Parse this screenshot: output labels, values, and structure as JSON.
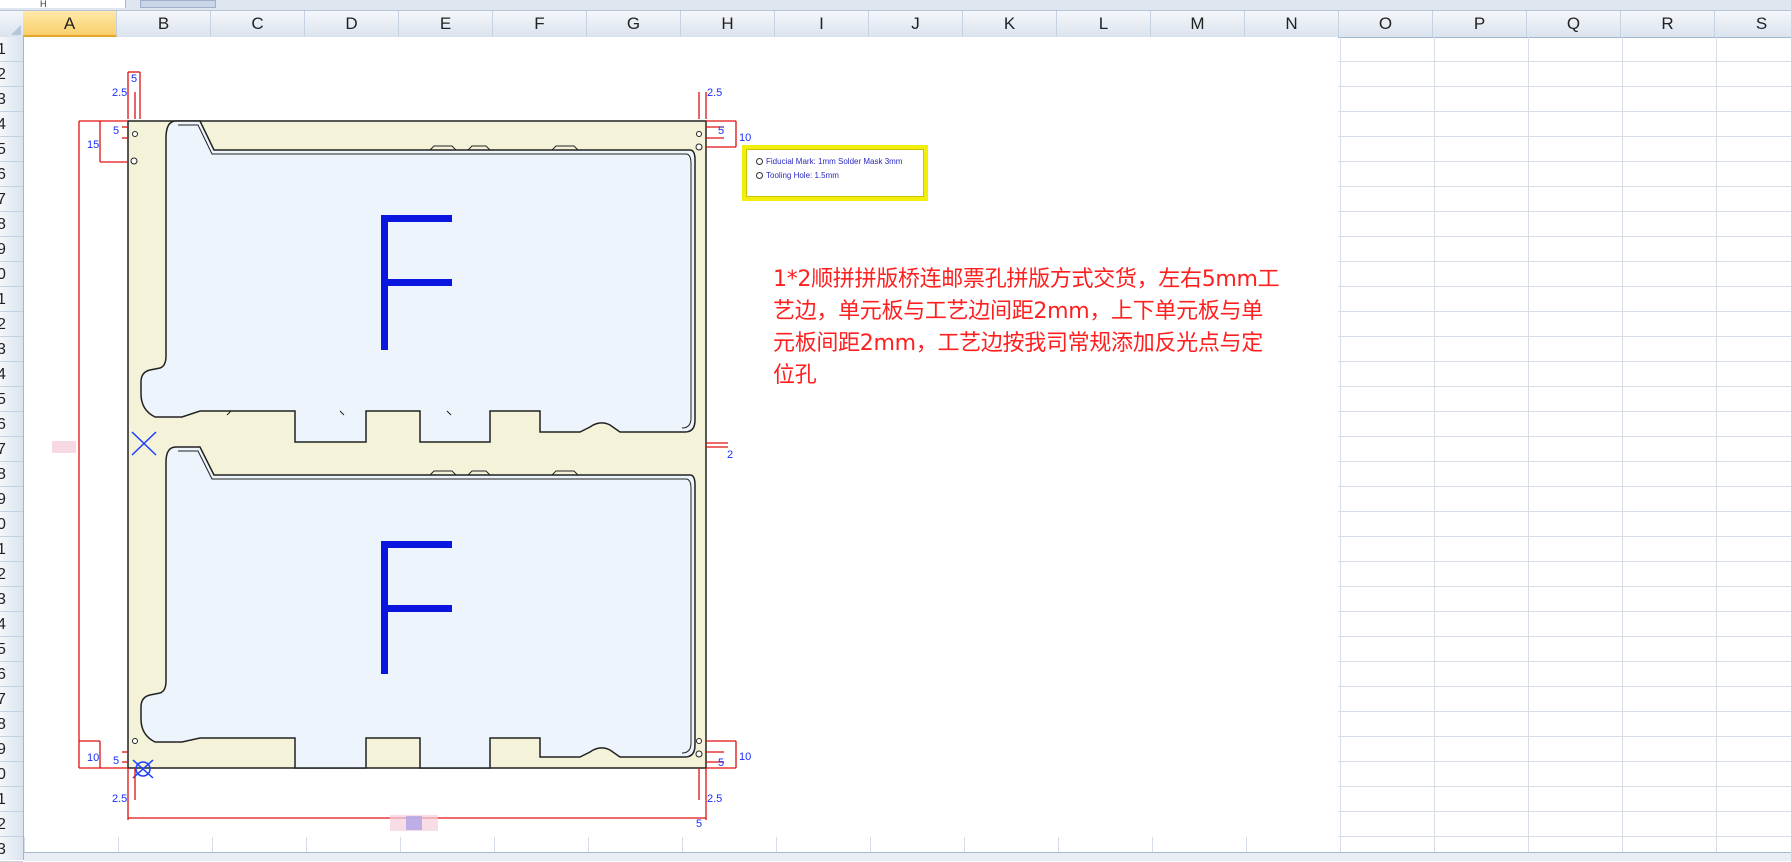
{
  "toolbar": {
    "name_box": "H"
  },
  "columns": [
    "A",
    "B",
    "C",
    "D",
    "E",
    "F",
    "G",
    "H",
    "I",
    "J",
    "K",
    "L",
    "M",
    "N",
    "O",
    "P",
    "Q",
    "R",
    "S"
  ],
  "rows": [
    "1",
    "2",
    "3",
    "4",
    "5",
    "6",
    "7",
    "8",
    "9",
    "0",
    "1",
    "2",
    "3",
    "4",
    "5",
    "6",
    "7",
    "8",
    "9",
    "0",
    "1",
    "2",
    "3",
    "4",
    "5",
    "6",
    "7",
    "8",
    "9",
    "0",
    "1",
    "2",
    "3"
  ],
  "selected_column": "A",
  "drawing": {
    "panel_letter_top": "F",
    "panel_letter_bottom": "F",
    "dimensions": {
      "top_left_width": "5",
      "top_left_offset": "2.5",
      "left_height": "15",
      "top_left_small": "5",
      "top_right_offset": "2.5",
      "top_right_small": "5",
      "top_right_height": "10",
      "middle_gap": "2",
      "bottom_left_height": "10",
      "bottom_left_small": "5",
      "bottom_left_offset": "2.5",
      "bottom_right_height": "10",
      "bottom_right_small": "5",
      "bottom_right_offset": "2.5",
      "bottom_width": "5"
    },
    "legend": {
      "line1": "Fiducial Mark: 1mm Solder Mask 3mm",
      "line2": "Tooling Hole: 1.5mm"
    }
  },
  "note": "1*2顺拼拼版桥连邮票孔拼版方式交货，左右5mm工艺边，单元板与工艺边间距2mm，上下单元板与单元板间距2mm，工艺边按我司常规添加反光点与定位孔",
  "colors": {
    "note": "#ff1f1f",
    "panel_fill": "#f4f3d9",
    "board_fill": "#eef4fb",
    "dimension": "#e01010",
    "letter": "#0a16e0",
    "legend_border": "#f2ee0c"
  }
}
